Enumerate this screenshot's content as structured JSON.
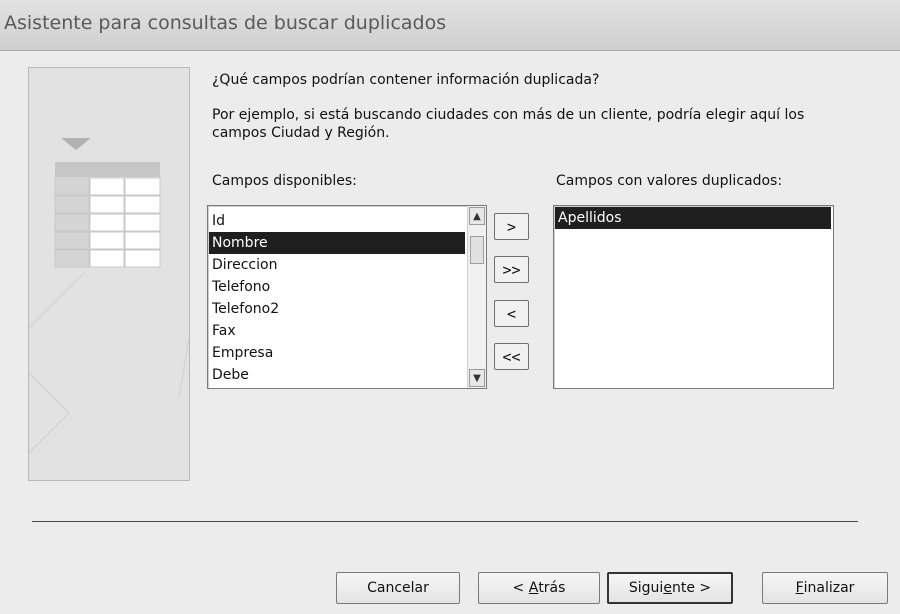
{
  "window": {
    "title": "Asistente para consultas de buscar duplicados"
  },
  "question": "¿Qué campos podrían contener información duplicada?",
  "example": "Por ejemplo, si está buscando ciudades con más de un cliente, podría elegir aquí los campos Ciudad y Región.",
  "available": {
    "label": "Campos disponibles:",
    "items": [
      "Id",
      "Nombre",
      "Direccion",
      "Telefono",
      "Telefono2",
      "Fax",
      "Empresa",
      "Debe"
    ],
    "selected": "Nombre"
  },
  "duplicates": {
    "label": "Campos con valores duplicados:",
    "items": [
      "Apellidos"
    ],
    "selected": "Apellidos"
  },
  "move_buttons": {
    "add_one": ">",
    "add_all": ">>",
    "remove_one": "<",
    "remove_all": "<<"
  },
  "footer": {
    "cancel": "Cancelar",
    "back_pre": "< ",
    "back_hot": "A",
    "back_post": "trás",
    "next_pre": "Sigui",
    "next_hot": "e",
    "next_post": "nte >",
    "finish_hot": "F",
    "finish_post": "inalizar"
  }
}
